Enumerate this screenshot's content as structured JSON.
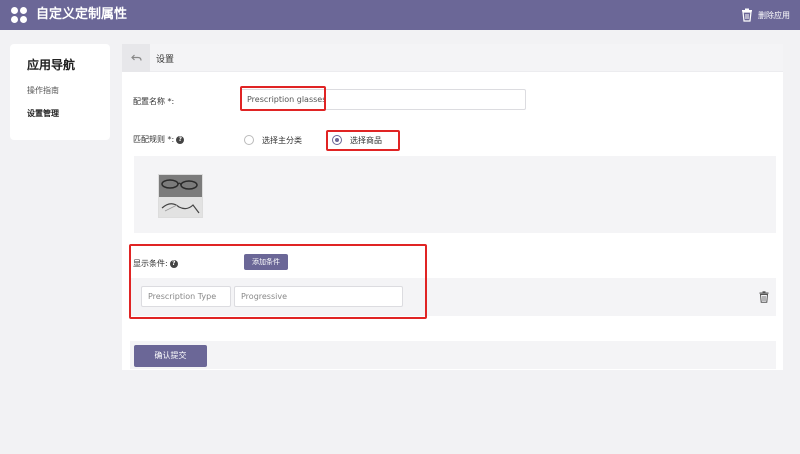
{
  "header": {
    "app_title": "自定义定制属性",
    "uninstall_label": "删除应用"
  },
  "sidebar": {
    "title": "应用导航",
    "items": [
      {
        "label": "操作指南",
        "active": false
      },
      {
        "label": "设置管理",
        "active": true
      }
    ]
  },
  "main": {
    "section_title": "设置",
    "config_name": {
      "label": "配置名称 *:",
      "value": "Prescription glasses"
    },
    "match_rule": {
      "label": "匹配规则 *:",
      "options": [
        {
          "label": "选择主分类",
          "checked": false
        },
        {
          "label": "选择商品",
          "checked": true
        }
      ]
    },
    "display_condition": {
      "label": "显示条件:",
      "add_button": "添加条件",
      "conditions": [
        {
          "field": "Prescription Type",
          "value": "Progressive"
        }
      ]
    },
    "submit_label": "确认提交"
  },
  "icons": {
    "logo": "clover-logo-icon",
    "uninstall": "trash-uninstall-icon",
    "back": "back-arrow-icon",
    "help": "help-icon",
    "delete": "trash-icon"
  },
  "colors": {
    "accent": "#6b6797",
    "highlight": "#e02424",
    "background": "#f2f2f4"
  }
}
